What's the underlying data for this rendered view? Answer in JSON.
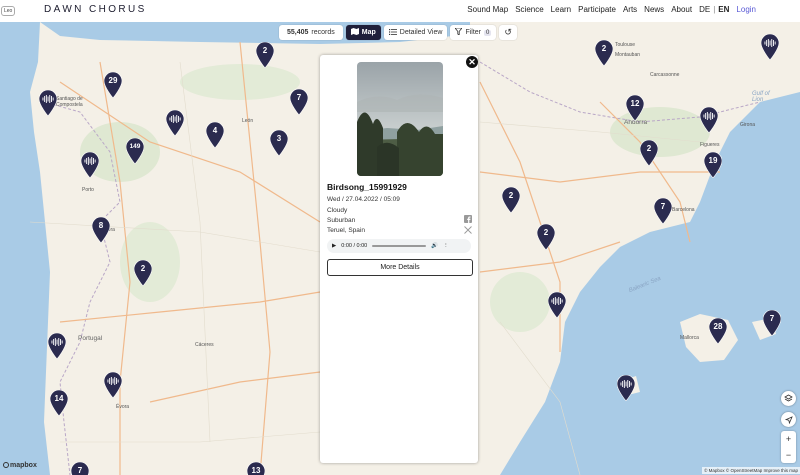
{
  "app": {
    "lang_chip": "Leo",
    "logo": "DAWN CHORUS",
    "nav": [
      "Sound Map",
      "Science",
      "Learn",
      "Participate",
      "Arts",
      "News",
      "About"
    ],
    "lang_de": "DE",
    "lang_en": "EN",
    "login": "Login"
  },
  "toolbar": {
    "count_value": "55,405",
    "count_label": "records",
    "map_label": "Map",
    "detailed_label": "Detailed View",
    "filter_label": "Filter",
    "filter_count": "0",
    "icons": [
      "map-icon",
      "list-icon",
      "filter-icon",
      "reset-icon"
    ]
  },
  "popup": {
    "title": "Birdsong_15991929",
    "datetime": "Wed / 27.04.2022 / 05:09",
    "weather": "Cloudy",
    "environment": "Suburban",
    "location": "Teruel, Spain",
    "audio_time": "0:00 / 0:00",
    "more_button": "More Details",
    "share_icons": [
      "facebook-icon",
      "x-icon"
    ]
  },
  "map": {
    "labels": {
      "portugal": "Portugal",
      "andorra": "Andorra",
      "balearic": "Balearic Sea",
      "gulf": "Gulf of Lion",
      "mallorca": "Mallorca",
      "toulouse": "Toulouse",
      "carcassonne": "Carcassonne",
      "figueres": "Figueres",
      "barcelona": "Barcelona",
      "leon": "León",
      "porto": "Porto",
      "evora": "Évora",
      "coimbra": "Coimbra",
      "caceres": "Cáceres",
      "girona": "Girona",
      "santiago": "Santiago de Compostela",
      "mons": "Montauban"
    },
    "pins": [
      {
        "kind": "num",
        "value": "2"
      },
      {
        "kind": "num",
        "value": "29"
      },
      {
        "kind": "wave"
      },
      {
        "kind": "wave"
      },
      {
        "kind": "num",
        "value": "7"
      },
      {
        "kind": "num",
        "value": "4"
      },
      {
        "kind": "num",
        "value": "3"
      },
      {
        "kind": "num",
        "value": "149"
      },
      {
        "kind": "wave"
      },
      {
        "kind": "num",
        "value": "8"
      },
      {
        "kind": "num",
        "value": "2"
      },
      {
        "kind": "wave"
      },
      {
        "kind": "wave"
      },
      {
        "kind": "num",
        "value": "14"
      },
      {
        "kind": "num",
        "value": "2"
      },
      {
        "kind": "num",
        "value": "12"
      },
      {
        "kind": "wave"
      },
      {
        "kind": "num",
        "value": "2"
      },
      {
        "kind": "num",
        "value": "19"
      },
      {
        "kind": "num",
        "value": "7"
      },
      {
        "kind": "num",
        "value": "2"
      },
      {
        "kind": "num",
        "value": "2"
      },
      {
        "kind": "wave"
      },
      {
        "kind": "num",
        "value": "28"
      },
      {
        "kind": "num",
        "value": "7"
      },
      {
        "kind": "wave"
      },
      {
        "kind": "wave"
      },
      {
        "kind": "num",
        "value": "7"
      },
      {
        "kind": "num",
        "value": "13"
      }
    ],
    "controls": [
      "layers-icon",
      "locate-icon"
    ],
    "zoom_in": "+",
    "zoom_out": "−",
    "logo": "mapbox",
    "attribution": "© Mapbox © OpenStreetMap Improve this map"
  },
  "colors": {
    "pin": "#2b2b4f",
    "land": "#f4f0e7",
    "sea": "#a9cbe6",
    "road": "#f0b98c"
  }
}
